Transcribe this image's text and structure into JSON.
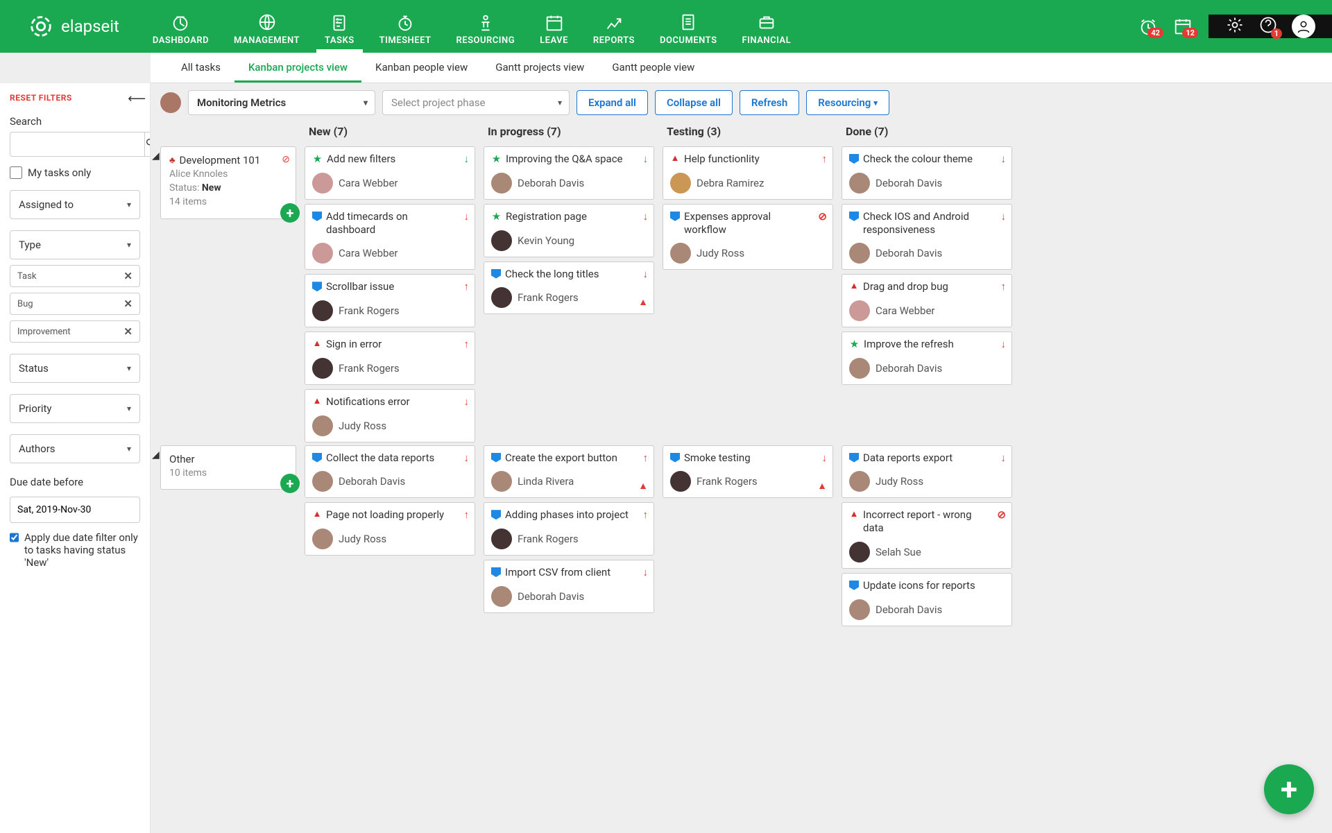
{
  "brand": "elapseit",
  "nav": [
    "DASHBOARD",
    "MANAGEMENT",
    "TASKS",
    "TIMESHEET",
    "RESOURCING",
    "LEAVE",
    "REPORTS",
    "DOCUMENTS",
    "FINANCIAL"
  ],
  "nav_active": 2,
  "alerts": {
    "clock_badge": "42",
    "cal_badge": "12",
    "help_badge": "1"
  },
  "subtabs": [
    "All tasks",
    "Kanban projects view",
    "Kanban people view",
    "Gantt projects view",
    "Gantt people view"
  ],
  "subtabs_active": 1,
  "sidebar": {
    "reset": "RESET FILTERS",
    "search_label": "Search",
    "my_tasks": "My tasks only",
    "assigned": "Assigned to",
    "type": "Type",
    "type_chips": [
      "Task",
      "Bug",
      "Improvement"
    ],
    "status": "Status",
    "priority": "Priority",
    "authors": "Authors",
    "due_label": "Due date before",
    "due_value": "Sat, 2019-Nov-30",
    "apply_due": "Apply due date filter only to tasks having status 'New'"
  },
  "toolbar": {
    "project": "Monitoring Metrics",
    "phase_placeholder": "Select project phase",
    "expand": "Expand all",
    "collapse": "Collapse all",
    "refresh": "Refresh",
    "resourcing": "Resourcing"
  },
  "columns": [
    "New (7)",
    "In progress (7)",
    "Testing (3)",
    "Done (7)"
  ],
  "groups": [
    {
      "name": "Development 101",
      "owner": "Alice Knnoles",
      "status_label": "Status:",
      "status_value": "New",
      "items": "14 items",
      "red_icon": true,
      "cols": [
        [
          {
            "type": "star",
            "t": "Add new filters",
            "p": "down",
            "a": "Cara Webber",
            "av": "c1"
          },
          {
            "type": "flag",
            "t": "Add timecards on dashboard",
            "p": "down-red",
            "a": "Cara Webber",
            "av": "c1"
          },
          {
            "type": "flag",
            "t": "Scrollbar issue",
            "p": "up",
            "a": "Frank Rogers",
            "av": "c5"
          },
          {
            "type": "warn",
            "t": "Sign in error",
            "p": "up",
            "a": "Frank Rogers",
            "av": "c5"
          },
          {
            "type": "warn",
            "t": "Notifications error",
            "p": "down-red",
            "a": "Judy Ross",
            "av": "c2"
          }
        ],
        [
          {
            "type": "star",
            "t": "Improving the Q&A space",
            "p": "down",
            "a": "Deborah Davis",
            "av": "c2"
          },
          {
            "type": "star",
            "t": "Registration page",
            "p": "down-red",
            "a": "Kevin Young",
            "av": "c5"
          },
          {
            "type": "flag",
            "t": "Check the long titles",
            "p": "down-red",
            "a": "Frank Rogers",
            "av": "c5",
            "warn": true
          }
        ],
        [
          {
            "type": "warn",
            "t": "Help functionlity",
            "p": "up",
            "a": "Debra Ramirez",
            "av": "c3"
          },
          {
            "type": "flag",
            "t": "Expenses approval workflow",
            "p": "circle",
            "a": "Judy Ross",
            "av": "c2"
          }
        ],
        [
          {
            "type": "flag",
            "t": "Check the colour theme",
            "p": "down-red",
            "a": "Deborah Davis",
            "av": "c2"
          },
          {
            "type": "flag",
            "t": "Check IOS and Android responsiveness",
            "p": "down-red",
            "a": "Deborah Davis",
            "av": "c2"
          },
          {
            "type": "warn",
            "t": "Drag and drop bug",
            "p": "up",
            "a": "Cara Webber",
            "av": "c1"
          },
          {
            "type": "star",
            "t": "Improve the refresh",
            "p": "down-red",
            "a": "Deborah Davis",
            "av": "c2"
          }
        ]
      ]
    },
    {
      "name": "Other",
      "items": "10 items",
      "cols": [
        [
          {
            "type": "flag",
            "t": "Collect the data reports",
            "p": "down-red",
            "a": "Deborah Davis",
            "av": "c2"
          },
          {
            "type": "warn",
            "t": "Page not loading properly",
            "p": "up",
            "a": "Judy Ross",
            "av": "c2"
          }
        ],
        [
          {
            "type": "flag",
            "t": "Create the export button",
            "p": "up",
            "a": "Linda Rivera",
            "av": "c2",
            "warn": true
          },
          {
            "type": "flag",
            "t": "Adding phases into project",
            "p": "up",
            "a": "Frank Rogers",
            "av": "c5"
          },
          {
            "type": "flag",
            "t": "Import CSV from client",
            "p": "down-red",
            "a": "Deborah Davis",
            "av": "c2"
          }
        ],
        [
          {
            "type": "flag",
            "t": "Smoke testing",
            "p": "down-red",
            "a": "Frank Rogers",
            "av": "c5",
            "warn": true
          }
        ],
        [
          {
            "type": "flag",
            "t": "Data reports export",
            "p": "down-red",
            "a": "Judy Ross",
            "av": "c2"
          },
          {
            "type": "warn",
            "t": "Incorrect report - wrong data",
            "p": "circle",
            "a": "Selah Sue",
            "av": "c5"
          },
          {
            "type": "flag",
            "t": "Update icons for reports",
            "p": "",
            "a": "Deborah Davis",
            "av": "c2"
          }
        ]
      ]
    }
  ]
}
